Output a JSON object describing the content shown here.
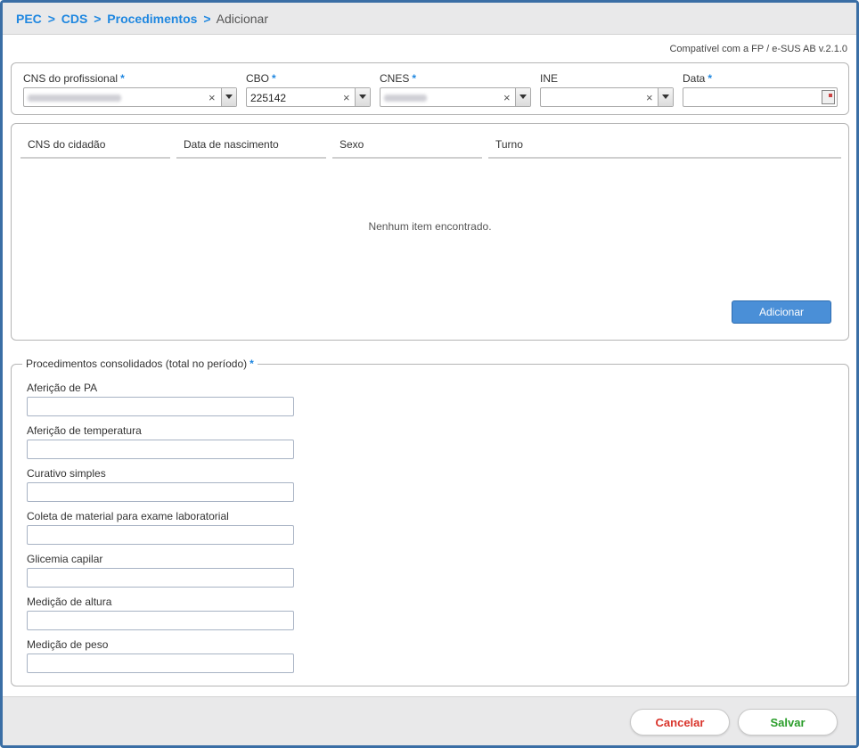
{
  "breadcrumb": {
    "items": [
      "PEC",
      "CDS",
      "Procedimentos"
    ],
    "separator": ">",
    "current": "Adicionar"
  },
  "version": "Compatível com a FP / e-SUS AB v.2.1.0",
  "header_fields": {
    "cns_profissional": {
      "label": "CNS do profissional",
      "required": true,
      "value_redacted": true
    },
    "cbo": {
      "label": "CBO",
      "required": true,
      "value": "225142"
    },
    "cnes": {
      "label": "CNES",
      "required": true,
      "value_redacted": true
    },
    "ine": {
      "label": "INE",
      "required": false,
      "value": ""
    },
    "data": {
      "label": "Data",
      "required": true,
      "value": ""
    },
    "required_marker": "*"
  },
  "citizens_table": {
    "columns": [
      "CNS do cidadão",
      "Data de nascimento",
      "Sexo",
      "Turno"
    ],
    "empty_message": "Nenhum item encontrado.",
    "add_button": "Adicionar"
  },
  "procedures": {
    "legend": "Procedimentos consolidados (total no período)",
    "required": true,
    "items": [
      {
        "label": "Aferição de PA",
        "value": ""
      },
      {
        "label": "Aferição de temperatura",
        "value": ""
      },
      {
        "label": "Curativo simples",
        "value": ""
      },
      {
        "label": "Coleta de material para exame laboratorial",
        "value": ""
      },
      {
        "label": "Glicemia capilar",
        "value": ""
      },
      {
        "label": "Medição de altura",
        "value": ""
      },
      {
        "label": "Medição de peso",
        "value": ""
      }
    ]
  },
  "footer": {
    "cancel": "Cancelar",
    "save": "Salvar"
  },
  "colors": {
    "accent": "#1f87e0",
    "frame": "#3a6ea5",
    "add_button": "#4a8fd7",
    "cancel_text": "#d9342b",
    "save_text": "#2a9d2a"
  },
  "icons": {
    "clear": "clear-icon",
    "dropdown": "chevron-down-icon",
    "calendar": "calendar-icon"
  }
}
